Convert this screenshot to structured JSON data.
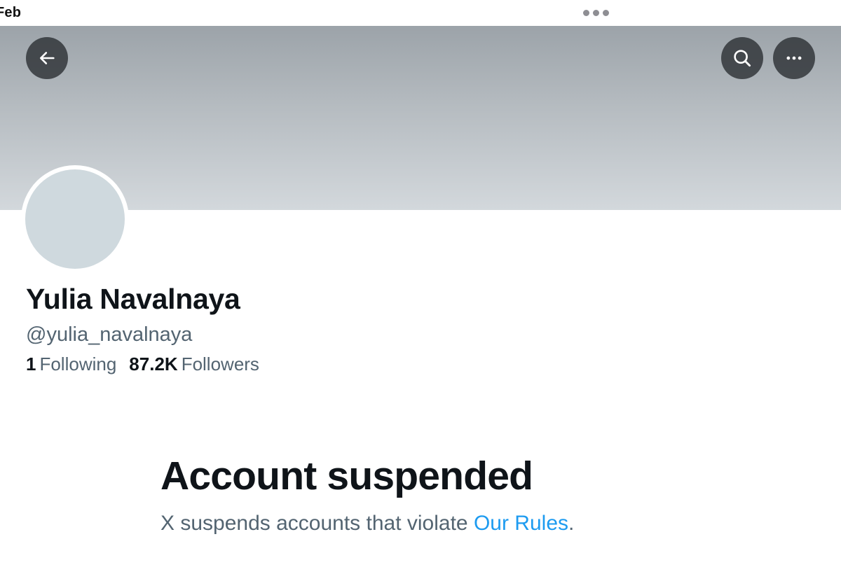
{
  "status_bar": {
    "date_fragment": "Feb"
  },
  "header": {
    "back_icon": "arrow-left-icon",
    "search_icon": "search-icon",
    "more_icon": "more-horizontal-icon",
    "banner_color_top": "#9ca3a9",
    "banner_color_bottom": "#d3d8dc"
  },
  "profile": {
    "display_name": "Yulia Navalnaya",
    "handle": "@yulia_navalnaya",
    "following_count": "1",
    "following_label": "Following",
    "followers_count": "87.2K",
    "followers_label": "Followers",
    "avatar_placeholder_color": "#cfd9de"
  },
  "notice": {
    "title": "Account suspended",
    "text_before": "X suspends accounts that violate ",
    "link_text": "Our Rules",
    "text_after": ".",
    "link_color": "#1d9bf0"
  }
}
